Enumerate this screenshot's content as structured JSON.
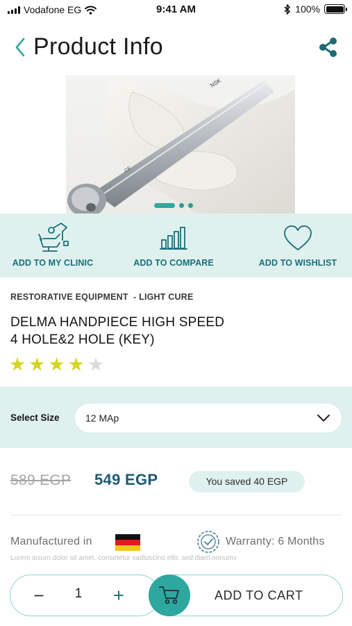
{
  "status_bar": {
    "carrier": "Vodafone EG",
    "time": "9:41 AM",
    "battery": "100%"
  },
  "header": {
    "title": "Product Info",
    "back_icon": "chevron-left-icon",
    "share_icon": "share-icon"
  },
  "gallery": {
    "image": "dental-handpiece-photo",
    "total_slides": 3,
    "active_slide": 1
  },
  "actions": [
    {
      "label": "ADD TO MY CLINIC",
      "icon": "dental-chair-icon"
    },
    {
      "label": "ADD TO COMPARE",
      "icon": "bar-chart-icon"
    },
    {
      "label": "ADD TO WISHLIST",
      "icon": "heart-icon"
    }
  ],
  "product": {
    "category": "RESTORATIVE EQUIPMENT  - LIGHT CURE",
    "name_line1": "DELMA HANDPIECE HIGH SPEED",
    "name_line2": "4 HOLE&2 HOLE (KEY)",
    "rating": 4,
    "rating_max": 5
  },
  "size": {
    "label": "Select Size",
    "selected": "12 MAp"
  },
  "price": {
    "old": "589 EGP",
    "current": "549 EGP",
    "saved": "You saved 40 EGP"
  },
  "details": {
    "manufactured_label": "Manufactured in",
    "flag": "germany-flag",
    "warranty": "Warranty: 6 Months",
    "description_preview": "Lorem ipsum dolor sit amet, consetetur sadipscing elitr, sed diam nonumy"
  },
  "cart_bar": {
    "quantity": "1",
    "minus": "−",
    "plus": "+",
    "add_to_cart": "ADD TO CART"
  },
  "colors": {
    "accent": "#2ea89f",
    "panel_bg": "#dff1ef",
    "dark_teal": "#1a6e78",
    "price_blue": "#1e5a72",
    "star": "#d6d51f"
  }
}
